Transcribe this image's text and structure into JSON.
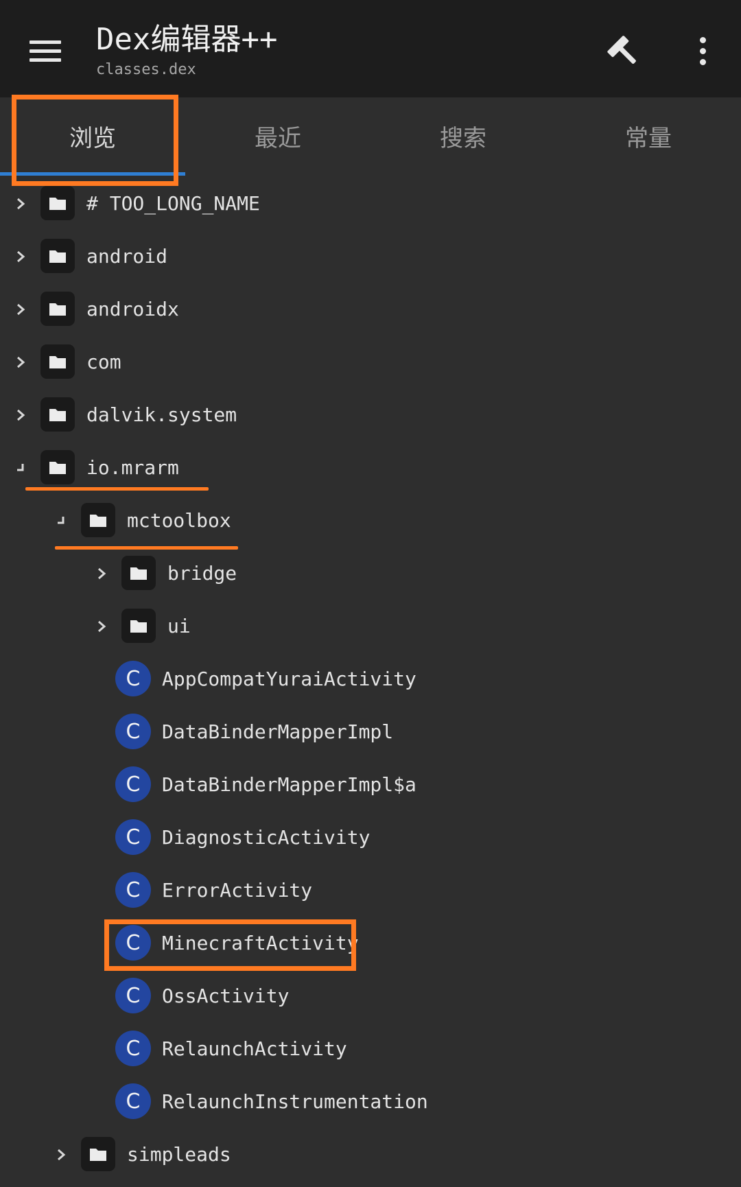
{
  "appbar": {
    "title": "Dex编辑器++",
    "subtitle": "classes.dex",
    "menu_icon": "hamburger-menu-icon",
    "build_icon": "hammer-icon",
    "more_icon": "more-vert-icon"
  },
  "tabs": [
    {
      "label": "浏览",
      "active": true
    },
    {
      "label": "最近",
      "active": false
    },
    {
      "label": "搜索",
      "active": false
    },
    {
      "label": "常量",
      "active": false
    }
  ],
  "tree": [
    {
      "type": "package",
      "label": "# TOO_LONG_NAME",
      "expanded": false,
      "depth": 0
    },
    {
      "type": "package",
      "label": "android",
      "expanded": false,
      "depth": 0
    },
    {
      "type": "package",
      "label": "androidx",
      "expanded": false,
      "depth": 0
    },
    {
      "type": "package",
      "label": "com",
      "expanded": false,
      "depth": 0
    },
    {
      "type": "package",
      "label": "dalvik.system",
      "expanded": false,
      "depth": 0
    },
    {
      "type": "package",
      "label": "io.mrarm",
      "expanded": true,
      "depth": 0
    },
    {
      "type": "package",
      "label": "mctoolbox",
      "expanded": true,
      "depth": 1
    },
    {
      "type": "package",
      "label": "bridge",
      "expanded": false,
      "depth": 2
    },
    {
      "type": "package",
      "label": "ui",
      "expanded": false,
      "depth": 2
    },
    {
      "type": "class",
      "label": "AppCompatYuraiActivity",
      "badge": "C",
      "depth": 2
    },
    {
      "type": "class",
      "label": "DataBinderMapperImpl",
      "badge": "C",
      "depth": 2
    },
    {
      "type": "class",
      "label": "DataBinderMapperImpl$a",
      "badge": "C",
      "depth": 2
    },
    {
      "type": "class",
      "label": "DiagnosticActivity",
      "badge": "C",
      "depth": 2
    },
    {
      "type": "class",
      "label": "ErrorActivity",
      "badge": "C",
      "depth": 2
    },
    {
      "type": "class",
      "label": "MinecraftActivity",
      "badge": "C",
      "depth": 2
    },
    {
      "type": "class",
      "label": "OssActivity",
      "badge": "C",
      "depth": 2
    },
    {
      "type": "class",
      "label": "RelaunchActivity",
      "badge": "C",
      "depth": 2
    },
    {
      "type": "class",
      "label": "RelaunchInstrumentation",
      "badge": "C",
      "depth": 2
    },
    {
      "type": "package",
      "label": "simpleads",
      "expanded": false,
      "depth": 1
    }
  ],
  "colors": {
    "appbar_bg": "#1d1d1d",
    "page_bg": "#2e2e2e",
    "tab_indicator": "#2f7fd4",
    "class_badge": "#2346a0",
    "annotation": "#ff7a22"
  }
}
